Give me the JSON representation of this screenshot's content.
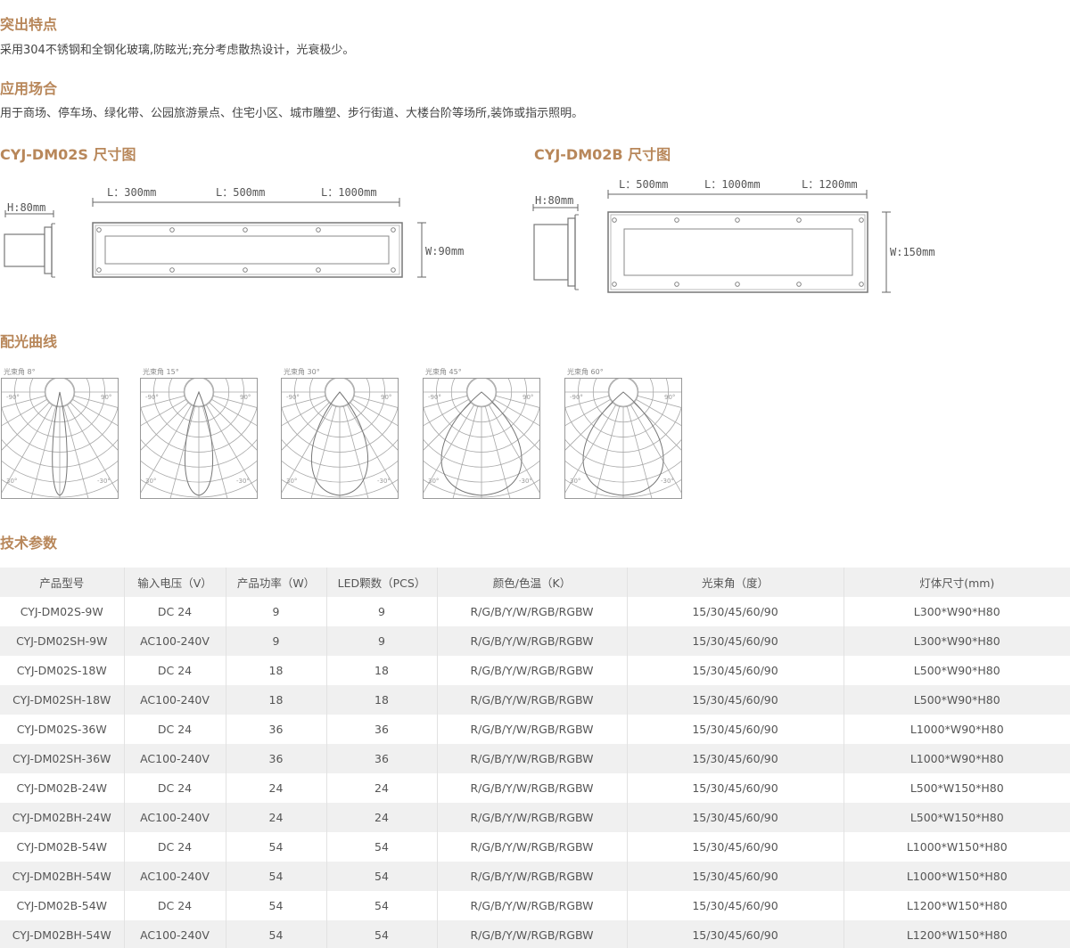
{
  "features": {
    "title": "突出特点",
    "text": "采用304不锈钢和全钢化玻璃,防眩光;充分考虑散热设计，光衰极少。"
  },
  "applications": {
    "title": "应用场合",
    "text": "用于商场、停车场、绿化带、公园旅游景点、住宅小区、城市雕塑、步行街道、大楼台阶等场所,装饰或指示照明。"
  },
  "dims": {
    "s": {
      "title": "CYJ-DM02S 尺寸图",
      "height": "H:80mm",
      "lengths": [
        "L：300mm",
        "L：500mm",
        "L：1000mm"
      ],
      "width": "W:90mm"
    },
    "b": {
      "title": "CYJ-DM02B 尺寸图",
      "height": "H:80mm",
      "lengths": [
        "L：500mm",
        "L：1000mm",
        "L：1200mm"
      ],
      "width": "W:150mm"
    }
  },
  "light_curves": {
    "title": "配光曲线",
    "items": [
      {
        "label": "光束角  8°",
        "beam": 8
      },
      {
        "label": "光束角 15°",
        "beam": 15
      },
      {
        "label": "光束角 30°",
        "beam": 30
      },
      {
        "label": "光束角 45°",
        "beam": 45
      },
      {
        "label": "光束角 60°",
        "beam": 60
      }
    ],
    "axis": {
      "left_top": "-90°",
      "right_top": "90°",
      "left_bottom": "30°",
      "right_bottom": "-30°"
    }
  },
  "specs": {
    "title": "技术参数",
    "headers": [
      "产品型号",
      "输入电压（V）",
      "产品功率（W）",
      "LED颗数（PCS）",
      "颜色/色温（K）",
      "光束角（度）",
      "灯体尺寸(mm)"
    ],
    "rows": [
      [
        "CYJ-DM02S-9W",
        "DC 24",
        "9",
        "9",
        "R/G/B/Y/W/RGB/RGBW",
        "15/30/45/60/90",
        "L300*W90*H80"
      ],
      [
        "CYJ-DM02SH-9W",
        "AC100-240V",
        "9",
        "9",
        "R/G/B/Y/W/RGB/RGBW",
        "15/30/45/60/90",
        "L300*W90*H80"
      ],
      [
        "CYJ-DM02S-18W",
        "DC 24",
        "18",
        "18",
        "R/G/B/Y/W/RGB/RGBW",
        "15/30/45/60/90",
        "L500*W90*H80"
      ],
      [
        "CYJ-DM02SH-18W",
        "AC100-240V",
        "18",
        "18",
        "R/G/B/Y/W/RGB/RGBW",
        "15/30/45/60/90",
        "L500*W90*H80"
      ],
      [
        "CYJ-DM02S-36W",
        "DC 24",
        "36",
        "36",
        "R/G/B/Y/W/RGB/RGBW",
        "15/30/45/60/90",
        "L1000*W90*H80"
      ],
      [
        "CYJ-DM02SH-36W",
        "AC100-240V",
        "36",
        "36",
        "R/G/B/Y/W/RGB/RGBW",
        "15/30/45/60/90",
        "L1000*W90*H80"
      ],
      [
        "CYJ-DM02B-24W",
        "DC 24",
        "24",
        "24",
        "R/G/B/Y/W/RGB/RGBW",
        "15/30/45/60/90",
        "L500*W150*H80"
      ],
      [
        "CYJ-DM02BH-24W",
        "AC100-240V",
        "24",
        "24",
        "R/G/B/Y/W/RGB/RGBW",
        "15/30/45/60/90",
        "L500*W150*H80"
      ],
      [
        "CYJ-DM02B-54W",
        "DC 24",
        "54",
        "54",
        "R/G/B/Y/W/RGB/RGBW",
        "15/30/45/60/90",
        "L1000*W150*H80"
      ],
      [
        "CYJ-DM02BH-54W",
        "AC100-240V",
        "54",
        "54",
        "R/G/B/Y/W/RGB/RGBW",
        "15/30/45/60/90",
        "L1000*W150*H80"
      ],
      [
        "CYJ-DM02B-54W",
        "DC 24",
        "54",
        "54",
        "R/G/B/Y/W/RGB/RGBW",
        "15/30/45/60/90",
        "L1200*W150*H80"
      ],
      [
        "CYJ-DM02BH-54W",
        "AC100-240V",
        "54",
        "54",
        "R/G/B/Y/W/RGB/RGBW",
        "15/30/45/60/90",
        "L1200*W150*H80"
      ]
    ]
  },
  "colors": {
    "accent": "#b8875a",
    "row_alt": "#f0f0f0"
  }
}
